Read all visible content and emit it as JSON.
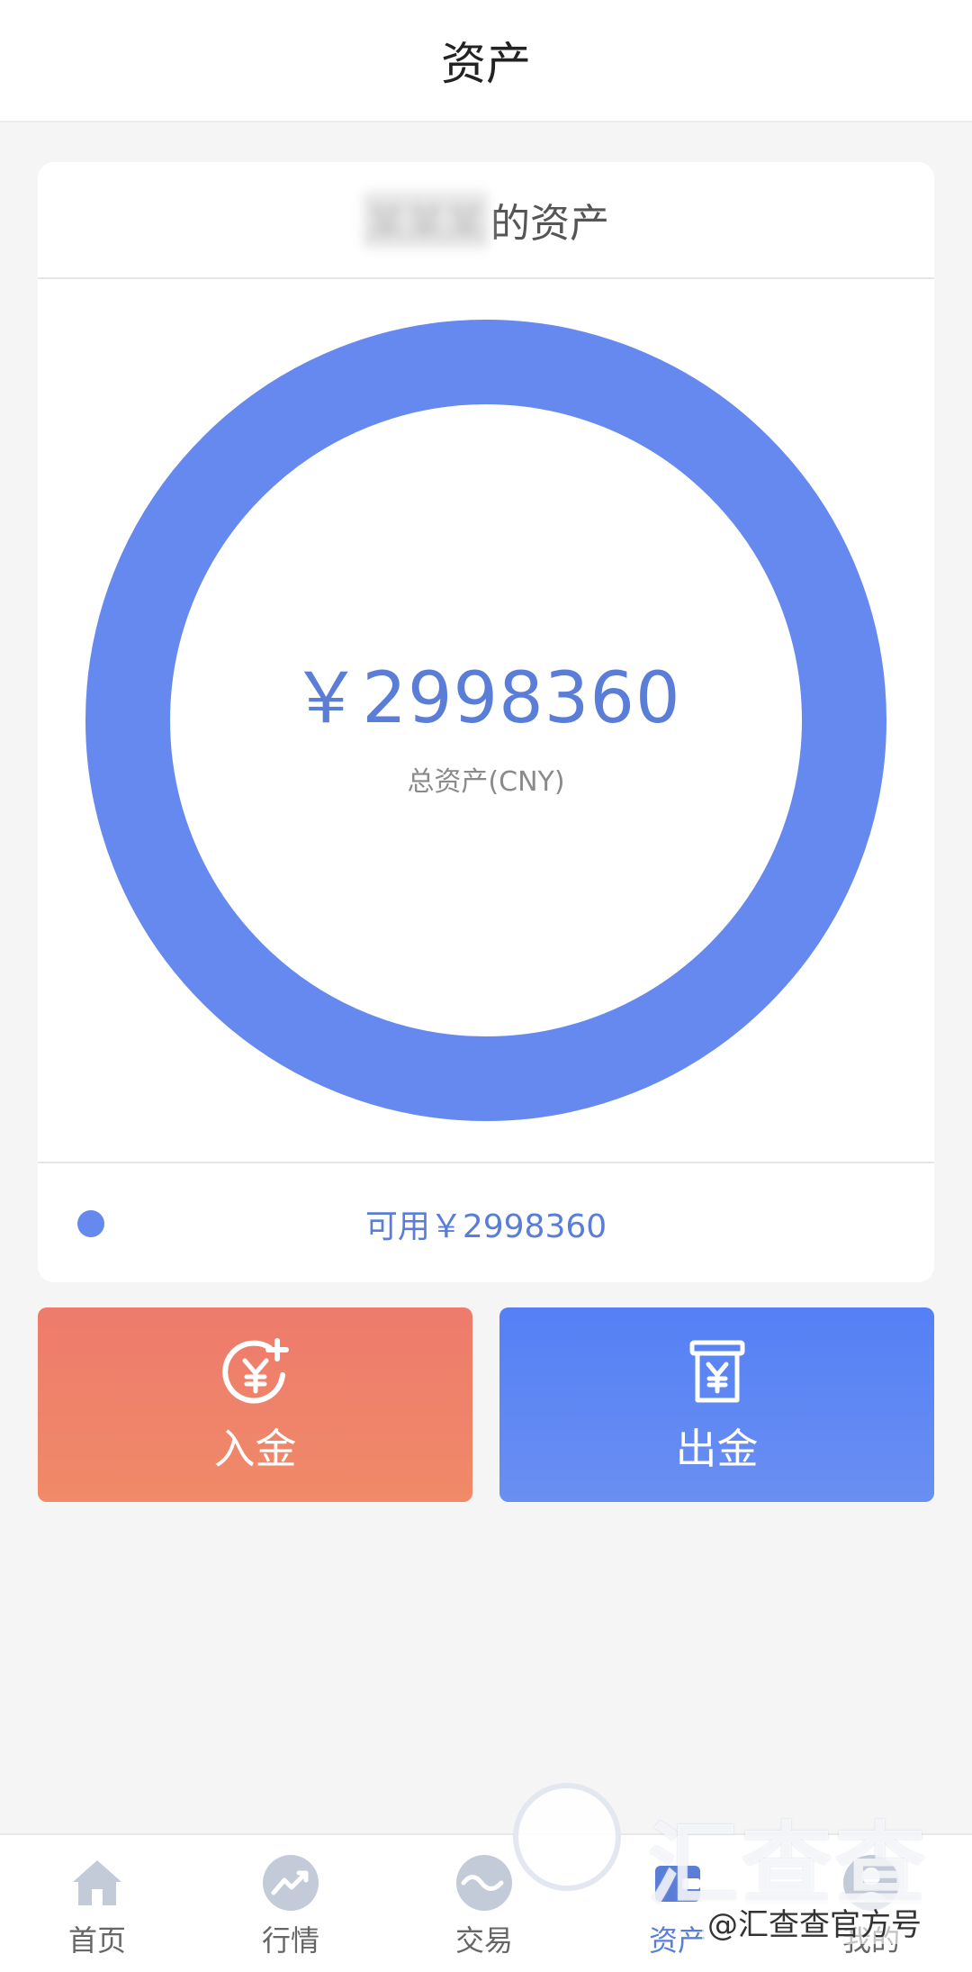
{
  "header": {
    "title": "资产"
  },
  "asset_card": {
    "owner_name": "某某某",
    "owner_suffix": "的资产",
    "total_amount": "￥2998360",
    "total_label": "总资产(CNY)",
    "available_text": "可用￥2998360",
    "ring_color": "#6589ee"
  },
  "actions": {
    "deposit_label": "入金",
    "withdraw_label": "出金",
    "deposit_color": "#ef7f6b",
    "withdraw_color": "#5a84f4",
    "deposit_icon": "yen-plus-icon",
    "withdraw_icon": "yen-withdraw-icon"
  },
  "bottom_nav": {
    "items": [
      {
        "label": "首页",
        "icon": "home-icon"
      },
      {
        "label": "行情",
        "icon": "trend-icon"
      },
      {
        "label": "交易",
        "icon": "trade-icon"
      },
      {
        "label": "资产",
        "icon": "wallet-icon",
        "active": true
      },
      {
        "label": "我的",
        "icon": "user-icon"
      }
    ]
  },
  "watermark": {
    "brand": "汇查查",
    "account": "@汇查查官方号"
  }
}
